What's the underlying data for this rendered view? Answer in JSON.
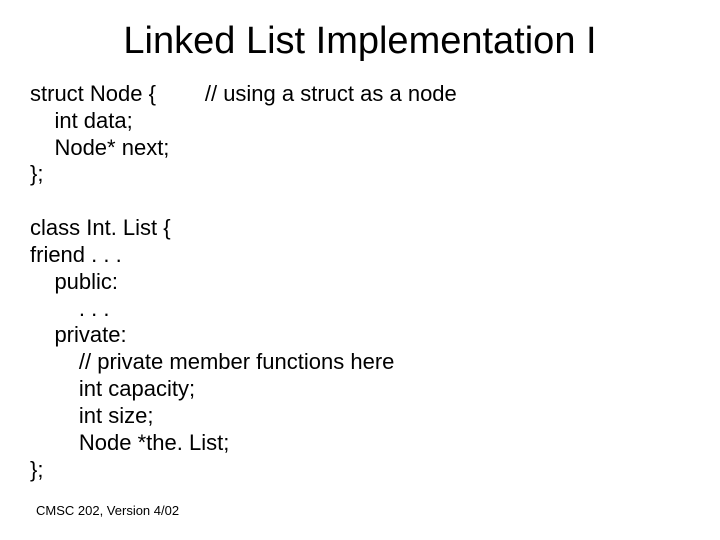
{
  "title": "Linked List Implementation I",
  "code": {
    "l1": "struct Node {        // using a struct as a node",
    "l2": "    int data;",
    "l3": "    Node* next;",
    "l4": "};",
    "l5": "",
    "l6": "class Int. List {",
    "l7": "friend . . .",
    "l8": "    public:",
    "l9": "        . . .",
    "l10": "    private:",
    "l11": "        // private member functions here",
    "l12": "        int capacity;",
    "l13": "        int size;",
    "l14": "        Node *the. List;",
    "l15": "};"
  },
  "footer": "CMSC 202, Version 4/02"
}
